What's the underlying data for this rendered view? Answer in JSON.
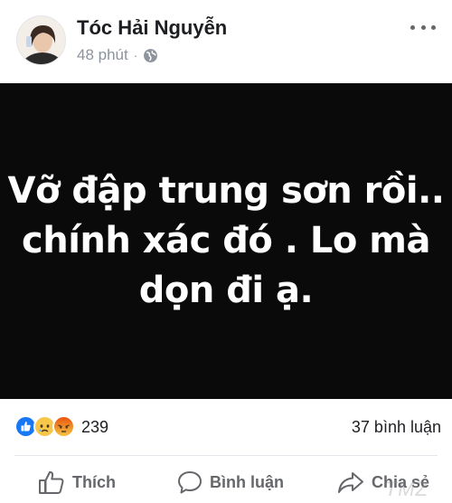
{
  "post": {
    "author": "Tóc Hải Nguyễn",
    "time": "48 phút",
    "separator": "·",
    "privacy_icon": "globe-icon",
    "more_icon": "more-options-icon",
    "image_text": "Vỡ đập trung sơn rồi..\nchính xác đó . Lo mà\ndọn đi ạ."
  },
  "reactions": {
    "icons": [
      "like-reaction-icon",
      "sad-reaction-icon",
      "angry-reaction-icon"
    ],
    "count": "239",
    "comments": "37 bình luận"
  },
  "actions": {
    "like": "Thích",
    "comment": "Bình luận",
    "share": "Chia sẻ"
  },
  "watermark": "TMZ",
  "colors": {
    "image_background": "#0a0a0a",
    "like_blue": "#1877f2",
    "angry_red": "#e9710f",
    "secondary_text": "#8d949e"
  }
}
